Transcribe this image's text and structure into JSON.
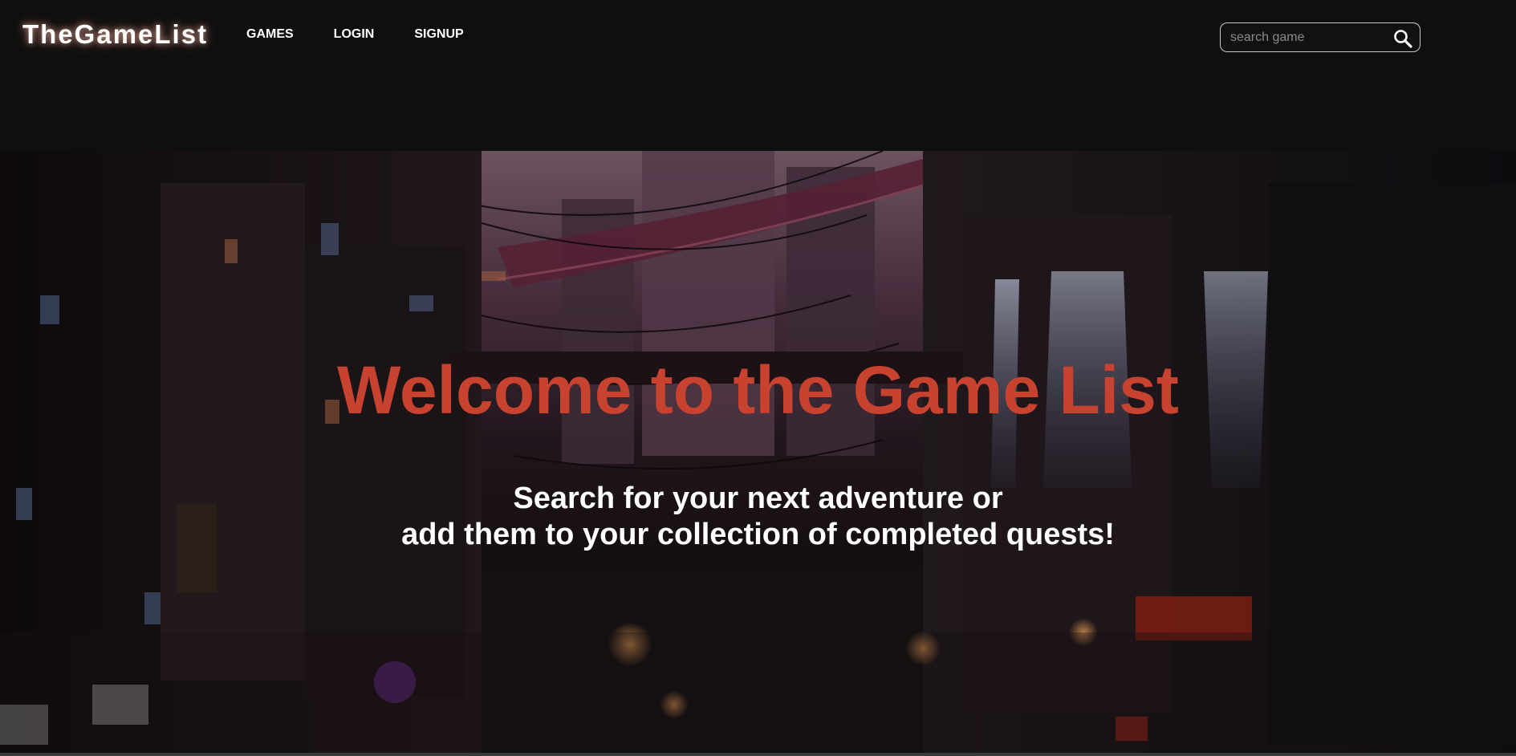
{
  "header": {
    "brand": "TheGameList",
    "nav": [
      {
        "label": "GAMES"
      },
      {
        "label": "LOGIN"
      },
      {
        "label": "SIGNUP"
      }
    ],
    "search": {
      "placeholder": "search game",
      "value": "",
      "icon": "search-icon"
    }
  },
  "hero": {
    "title": "Welcome to the Game List",
    "subtitle_line1": "Search for your next adventure or",
    "subtitle_line2": "add them to your collection of completed quests!",
    "background": "cyberpunk-city-street-illustration"
  },
  "colors": {
    "background": "#0f0f0f",
    "title": "#c8432f",
    "text": "#ffffff",
    "brand_glow": "#ffb8a8"
  }
}
